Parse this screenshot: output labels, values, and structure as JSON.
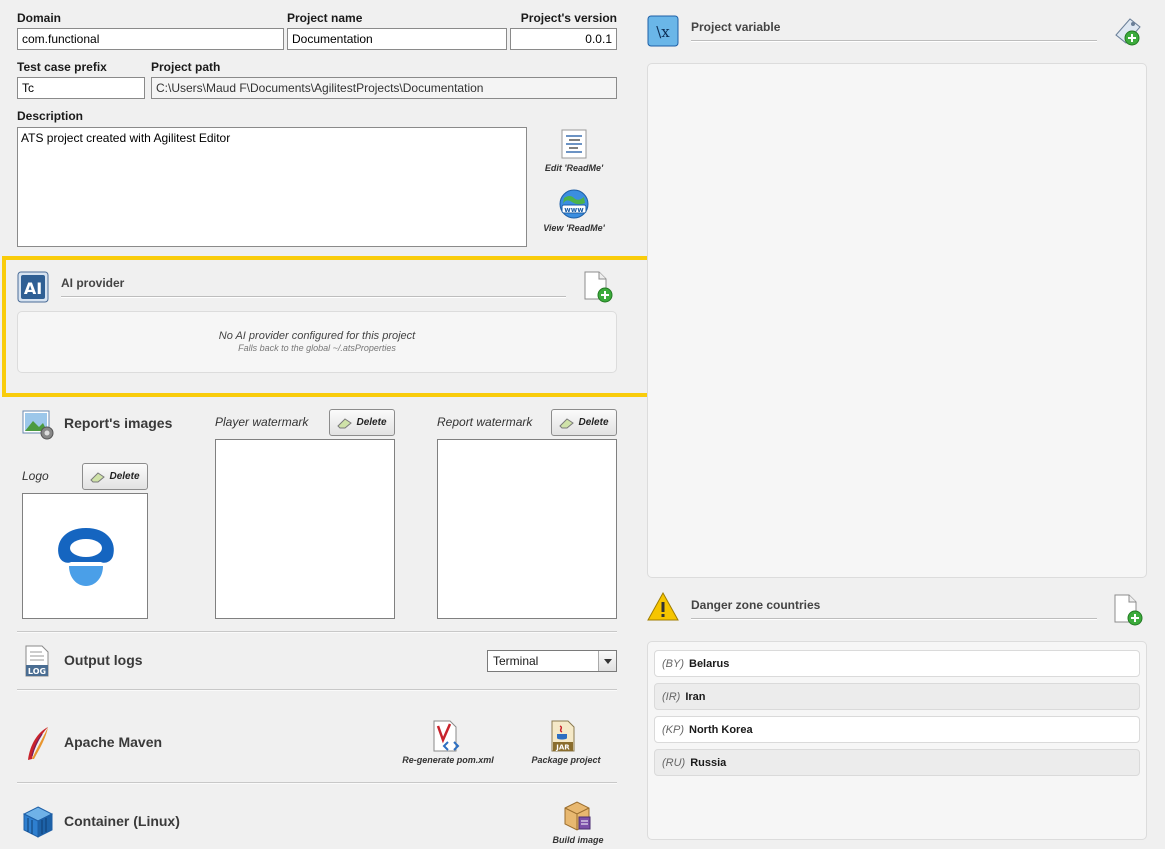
{
  "project": {
    "domain_label": "Domain",
    "domain_value": "com.functional",
    "name_label": "Project name",
    "name_value": "Documentation",
    "version_label": "Project's version",
    "version_value": "0.0.1",
    "prefix_label": "Test case prefix",
    "prefix_value": "Tc",
    "path_label": "Project path",
    "path_value": "C:\\Users\\Maud F\\Documents\\AgilitestProjects\\Documentation",
    "description_label": "Description",
    "description_value": "ATS project created with Agilitest Editor",
    "edit_readme": "Edit 'ReadMe'",
    "view_readme": "View 'ReadMe'"
  },
  "ai_provider": {
    "title": "AI provider",
    "empty_line1": "No AI provider configured for this project",
    "empty_line2": "Falls back to the global ~/.atsProperties",
    "highlight_color": "#f9cc0b"
  },
  "report_images": {
    "title": "Report's images",
    "player_label": "Player watermark",
    "report_label": "Report watermark",
    "logo_label": "Logo",
    "delete_label": "Delete"
  },
  "output_logs": {
    "title": "Output logs",
    "selected": "Terminal"
  },
  "maven": {
    "title": "Apache Maven",
    "regenerate": "Re-generate pom.xml",
    "package": "Package project"
  },
  "container": {
    "title": "Container (Linux)",
    "build": "Build image"
  },
  "variables": {
    "title": "Project variable"
  },
  "danger": {
    "title": "Danger zone countries",
    "countries": [
      {
        "code": "(BY)",
        "name": "Belarus"
      },
      {
        "code": "(IR)",
        "name": "Iran"
      },
      {
        "code": "(KP)",
        "name": "North Korea"
      },
      {
        "code": "(RU)",
        "name": "Russia"
      }
    ]
  }
}
